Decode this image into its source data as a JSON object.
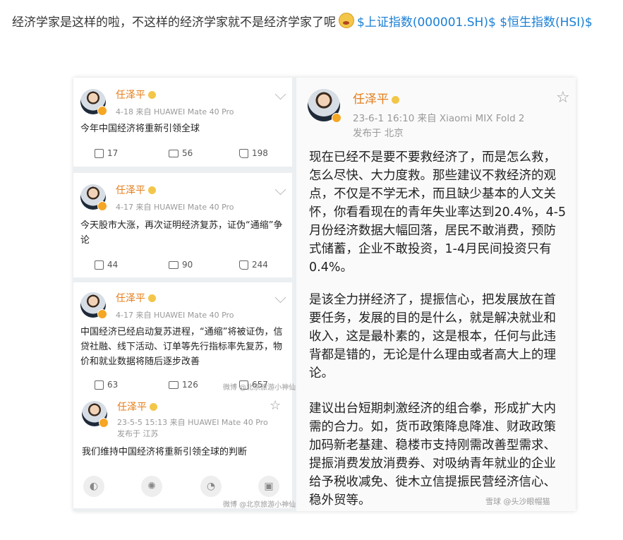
{
  "post": {
    "text": "经济学家是这样的啦，不这样的经济学家就不是经济学家了呢",
    "emoji": "surprised-emoji",
    "cashtag_1": "$上证指数(000001.SH)$",
    "cashtag_2": "$恒生指数(HSI)$"
  },
  "left_posts": [
    {
      "user": "任泽平",
      "meta": "4-18   来自 HUAWEI Mate 40 Pro",
      "text": "今年中国经济将重新引领全球",
      "reposts": "17",
      "comments": "56",
      "likes": "198"
    },
    {
      "user": "任泽平",
      "meta": "4-17   来自 HUAWEI Mate 40 Pro",
      "text": "今天股市大涨，再次证明经济复苏，证伪“通缩”争论",
      "reposts": "44",
      "comments": "90",
      "likes": "244"
    },
    {
      "user": "任泽平",
      "meta": "4-17   来自 HUAWEI Mate 40 Pro",
      "text": "中国经济已经启动复苏进程，“通缩”将被证伪，信贷社融、线下活动、订单等先行指标率先复苏，物价和就业数据将随后逐步改善",
      "reposts": "63",
      "comments": "126",
      "likes": "657"
    },
    {
      "user": "任泽平",
      "meta": "23-5-5 15:13   来自 HUAWEI Mate 40 Pro",
      "meta2": "发布于 江苏",
      "text": "我们维持中国经济将重新引领全球的判断"
    }
  ],
  "right_post": {
    "user": "任泽平",
    "meta": "23-6-1 16:10   来自 Xiaomi MIX Fold 2",
    "meta2": "发布于 北京",
    "paragraphs": [
      "现在已经不是要不要救经济了，而是怎么救，怎么尽快、大力度救。那些建议不救经济的观点，不仅是不学无术，而且缺少基本的人文关怀，你看看现在的青年失业率达到20.4%，4-5月份经济数据大幅回落，居民不敢消费，预防式储蓄，企业不敢投资，1-4月民间投资只有0.4%。",
      "是该全力拼经济了，提振信心，把发展放在首要任务，发展的目的是什么，就是解决就业和收入，这是最朴素的，这是根本，任何与此违背都是错的，无论是什么理由或者高大上的理论。",
      "建议出台短期刺激经济的组合拳，形成扩大内需的合力。如，货币政策降息降准、财政政策加码新老基建、稳楼市支持刚需改善型需求、提振消费发放消费券、对吸纳青年就业的企业给予税收减免、徙木立信提振民营经济信心、稳外贸等。"
    ]
  },
  "watermarks": {
    "left_mid": "微博 @北京旅游小神仙",
    "left_bottom": "微博 @北京旅游小神仙",
    "right_bottom": "雪球 @头沙眼帽猫"
  }
}
